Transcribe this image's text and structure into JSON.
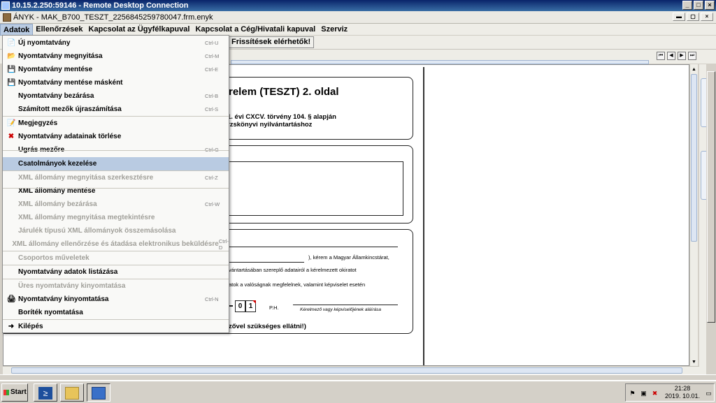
{
  "rdp": {
    "title": "10.15.2.250:59146 - Remote Desktop Connection"
  },
  "app": {
    "title": "ÁNYK - MAK_B700_TESZT_2256845259780047.frm.enyk"
  },
  "menubar": [
    {
      "label": "Adatok"
    },
    {
      "label": "Ellenőrzések"
    },
    {
      "label": "Kapcsolat az Ügyfélkapuval"
    },
    {
      "label": "Kapcsolat a Cég/Hivatali kapuval"
    },
    {
      "label": "Szerviz"
    }
  ],
  "toolbar": {
    "updates_label": "Frissítések elérhetők!"
  },
  "menu_items": [
    {
      "label": "Új nyomtatvány",
      "shortcut": "Ctrl-U",
      "icon": "new-form-icon",
      "glyph": "📄",
      "disabled": false
    },
    {
      "label": "Nyomtatvány megnyitása",
      "shortcut": "Ctrl-M",
      "icon": "open-form-icon",
      "glyph": "📂",
      "disabled": false
    },
    {
      "label": "Nyomtatvány mentése",
      "shortcut": "Ctrl-E",
      "icon": "save-icon",
      "glyph": "💾",
      "disabled": false
    },
    {
      "label": "Nyomtatvány mentése másként",
      "shortcut": "",
      "icon": "save-as-icon",
      "glyph": "💾",
      "disabled": false
    },
    {
      "label": "Nyomtatvány bezárása",
      "shortcut": "Ctrl-B",
      "icon": "",
      "glyph": "",
      "disabled": false
    },
    {
      "label": "Számított mezők újraszámítása",
      "shortcut": "Ctrl-S",
      "icon": "",
      "glyph": "",
      "disabled": false
    },
    {
      "label": "Megjegyzés",
      "shortcut": "",
      "icon": "note-icon",
      "glyph": "📝",
      "disabled": false
    },
    {
      "label": "Nyomtatvány adatainak törlése",
      "shortcut": "",
      "icon": "delete-icon",
      "glyph": "✖",
      "disabled": false
    },
    {
      "label": "Ugrás mezőre",
      "shortcut": "Ctrl-G",
      "icon": "",
      "glyph": "",
      "disabled": false
    },
    {
      "label": "Csatolmányok kezelése",
      "shortcut": "",
      "icon": "",
      "glyph": "",
      "disabled": false,
      "highlight": true
    },
    {
      "label": "XML állomány megnyitása szerkesztésre",
      "shortcut": "Ctrl-Z",
      "icon": "",
      "glyph": "",
      "disabled": true
    },
    {
      "label": "XML állomány mentése",
      "shortcut": "",
      "icon": "",
      "glyph": "",
      "disabled": false
    },
    {
      "label": "XML állomány bezárása",
      "shortcut": "Ctrl-W",
      "icon": "",
      "glyph": "",
      "disabled": true
    },
    {
      "label": "XML állomány megnyitása megtekintésre",
      "shortcut": "",
      "icon": "",
      "glyph": "",
      "disabled": true
    },
    {
      "label": "Járulék típusú XML állományok összemásolása",
      "shortcut": "",
      "icon": "",
      "glyph": "",
      "disabled": true
    },
    {
      "label": "XML állomány ellenőrzése és átadása elektronikus beküldésre",
      "shortcut": "Ctrl-D",
      "icon": "",
      "glyph": "",
      "disabled": true
    },
    {
      "label": "Csoportos műveletek",
      "shortcut": "",
      "icon": "",
      "glyph": "",
      "disabled": true
    },
    {
      "label": "Nyomtatvány adatok listázása",
      "shortcut": "",
      "icon": "",
      "glyph": "",
      "disabled": false
    },
    {
      "label": "Üres nyomtatvány kinyomtatása",
      "shortcut": "",
      "icon": "",
      "glyph": "",
      "disabled": true
    },
    {
      "label": "Nyomtatvány kinyomtatása",
      "shortcut": "Ctrl-N",
      "icon": "print-icon",
      "glyph": "🖨",
      "disabled": false
    },
    {
      "label": "Boríték nyomtatása",
      "shortcut": "",
      "icon": "",
      "glyph": "",
      "disabled": false
    },
    {
      "label": "Kilépés",
      "shortcut": "",
      "icon": "exit-icon",
      "glyph": "➜",
      "disabled": false
    }
  ],
  "document": {
    "heading": "relem (TESZT) 2. oldal",
    "sub_line1": "1. évi CXCV. törvény 104. § alapján",
    "sub_line2": "rzskönyvi nyilvántartáshoz",
    "para1": "), kérem a Magyar Államkincstárat,",
    "para2": "vántartásában szereplő adatairól a kérelmezett okiratot",
    "para3": "atok a valóságnak megfelelnek, valamint képviselet esetén",
    "digit1": "0",
    "digit2": "1",
    "ph_label": "P.H.",
    "signature_caption": "Kérelmező vagy képviselőjének aláírása",
    "footer_note": "zővel szükséges ellátni!)"
  },
  "taskbar": {
    "start_label": "Start",
    "time": "21:28",
    "date": "2019. 10.01."
  }
}
